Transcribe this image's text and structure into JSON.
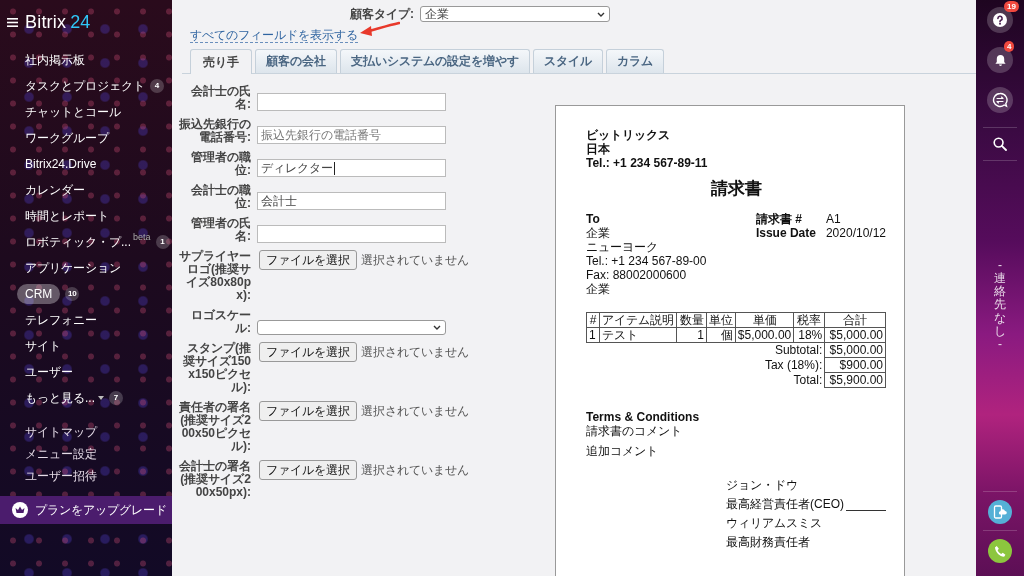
{
  "sidebar": {
    "logo_name": "Bitrix",
    "logo_number": "24",
    "items": [
      {
        "label": "社内掲示板",
        "kind": "link",
        "selected": false
      },
      {
        "label": "タスクとプロジェクト",
        "kind": "link",
        "selected": false,
        "badge": "4"
      },
      {
        "label": "チャットとコール",
        "kind": "link",
        "selected": false
      },
      {
        "label": "ワークグループ",
        "kind": "link",
        "selected": false
      },
      {
        "label": "Bitrix24.Drive",
        "kind": "link",
        "selected": false
      },
      {
        "label": "カレンダー",
        "kind": "link",
        "selected": false
      },
      {
        "label": "時間とレポート",
        "kind": "link",
        "selected": false
      },
      {
        "label": "ロボティック・プ...",
        "kind": "link",
        "selected": false,
        "tag": "beta",
        "badge": "1"
      },
      {
        "label": "アプリケーション",
        "kind": "link",
        "selected": false
      },
      {
        "label": "CRM",
        "kind": "link",
        "selected": true,
        "badge": "10"
      },
      {
        "label": "テレフォニー",
        "kind": "link",
        "selected": false
      },
      {
        "label": "サイト",
        "kind": "link",
        "selected": false
      },
      {
        "label": "ユーザー",
        "kind": "link",
        "selected": false
      },
      {
        "label": "もっと見る...",
        "kind": "more",
        "selected": false,
        "badge": "7"
      }
    ],
    "links": [
      "サイトマップ",
      "メニュー設定",
      "ユーザー招待"
    ],
    "upgrade": "プランをアップグレード"
  },
  "header": {
    "customer_type": {
      "label": "顧客タイプ:",
      "value": "企業"
    },
    "show_all_link": "すべてのフィールドを表示する"
  },
  "tabs": [
    {
      "label": "売り手",
      "selected": true
    },
    {
      "label": "顧客の会社",
      "selected": false
    },
    {
      "label": "支払いシステムの設定を増やす",
      "selected": false
    },
    {
      "label": "スタイル",
      "selected": false
    },
    {
      "label": "カラム",
      "selected": false
    }
  ],
  "fields": [
    {
      "label": "会計士の氏名:",
      "kind": "text",
      "focused": false
    },
    {
      "label": "振込先銀行の電話番号:",
      "kind": "text",
      "placeholder": "振込先銀行の電話番号",
      "focused": false
    },
    {
      "label": "管理者の職位:",
      "kind": "text",
      "value": "ディレクター",
      "focused": true
    },
    {
      "label": "会計士の職位:",
      "kind": "text",
      "value": "会計士",
      "focused": false
    },
    {
      "label": "管理者の氏名:",
      "kind": "text",
      "focused": false
    },
    {
      "label": "サプライヤーロゴ(推奨サイズ80x80px):",
      "kind": "file",
      "button": "ファイルを選択",
      "status": "選択されていません"
    },
    {
      "label": "ロゴスケール:",
      "kind": "select"
    },
    {
      "label": "スタンプ(推奨サイズ150x150ピクセル):",
      "kind": "file",
      "button": "ファイルを選択",
      "status": "選択されていません"
    },
    {
      "label": "責任者の署名 (推奨サイズ200x50ピクセル):",
      "kind": "file",
      "button": "ファイルを選択",
      "status": "選択されていません"
    },
    {
      "label": "会計士の署名(推奨サイズ200x50px):",
      "kind": "file",
      "button": "ファイルを選択",
      "status": "選択されていません"
    }
  ],
  "invoice": {
    "seller": [
      "ビットリックス",
      "日本",
      "Tel.: +1 234 567-89-11"
    ],
    "title": "請求書",
    "to_heading": "To",
    "to_lines": [
      "企業",
      "ニューヨーク",
      "Tel.: +1 234 567-89-00",
      "Fax: 88002000600",
      "企業"
    ],
    "meta": [
      {
        "label": "請求書 #",
        "value": "A1"
      },
      {
        "label": "Issue Date",
        "value": "2020/10/12"
      }
    ],
    "columns": [
      "#",
      "アイテム説明",
      "数量",
      "単位",
      "単価",
      "税率",
      "合計"
    ],
    "rows": [
      [
        "1",
        "テスト",
        "1",
        "個",
        "$5,000.00",
        "18%",
        "$5,000.00"
      ]
    ],
    "totals": [
      {
        "label": "Subtotal:",
        "value": "$5,000.00"
      },
      {
        "label": "Tax (18%):",
        "value": "$900.00"
      },
      {
        "label": "Total:",
        "value": "$5,900.00"
      }
    ],
    "terms_heading": "Terms & Conditions",
    "comments": [
      "請求書のコメント",
      "追加コメント"
    ],
    "signatures": [
      {
        "name": "ジョン・ドウ",
        "title": "最高経営責任者(CEO)",
        "signature_line": true
      },
      {
        "name": "ウィリアムスミス",
        "title": "最高財務責任者",
        "signature_line": false
      }
    ]
  },
  "right_bar": {
    "buttons": [
      {
        "kind": "help",
        "badge": "19"
      },
      {
        "kind": "notifications",
        "badge": "4"
      },
      {
        "kind": "chat"
      },
      {
        "kind": "search"
      }
    ],
    "contacts": "- 連絡先なし -",
    "bottom_buttons": [
      {
        "kind": "cloud-phone"
      },
      {
        "kind": "call"
      }
    ]
  }
}
